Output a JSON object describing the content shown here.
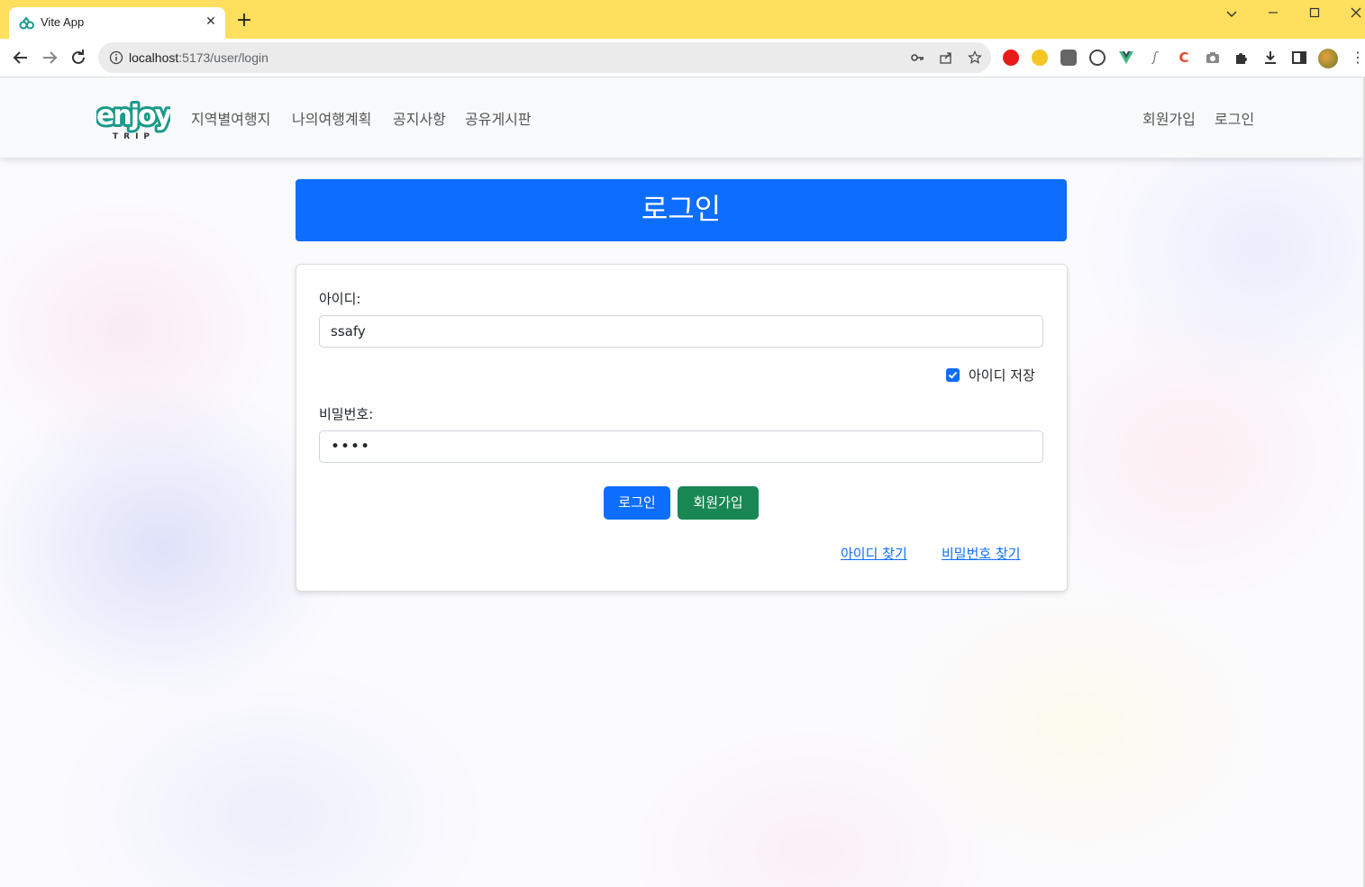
{
  "browser": {
    "tab_title": "Vite App",
    "url_host": "localhost",
    "url_path": ":5173/user/login"
  },
  "site": {
    "logo_text": "enjoy",
    "logo_subtext": "TRIP",
    "nav_left": [
      "지역별여행지",
      "나의여행계획",
      "공지사항",
      "공유게시판"
    ],
    "nav_right": [
      "회원가입",
      "로그인"
    ]
  },
  "login": {
    "header": "로그인",
    "id_label": "아이디:",
    "id_value": "ssafy",
    "save_id_label": "아이디 저장",
    "save_id_checked": true,
    "password_label": "비밀번호:",
    "password_value": "••••",
    "login_button": "로그인",
    "signup_button": "회원가입",
    "find_id_link": "아이디 찾기",
    "find_password_link": "비밀번호 찾기"
  },
  "colors": {
    "titlebar": "#ffdf5d",
    "primary": "#0d6efd",
    "success": "#198754",
    "logo_green": "#1a9a8a"
  }
}
